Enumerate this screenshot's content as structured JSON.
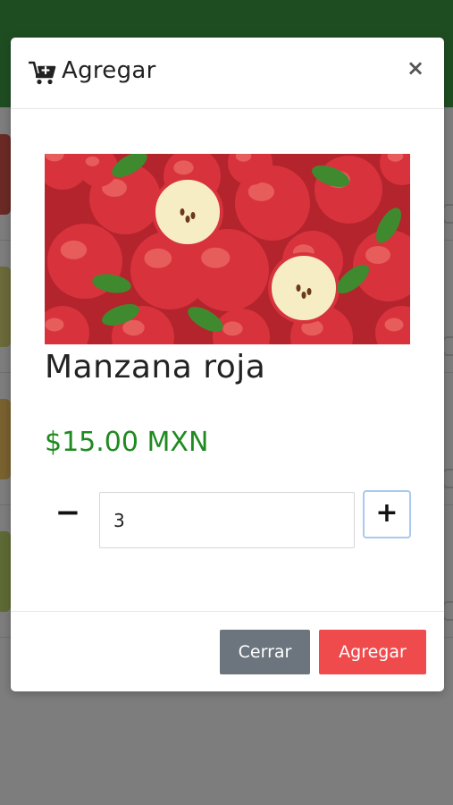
{
  "modal": {
    "title": "Agregar",
    "close_symbol": "×"
  },
  "product": {
    "name": "Manzana roja",
    "price": "$15.00 MXN",
    "image": "red-apples-photo"
  },
  "quantity": {
    "value": "3",
    "minus_symbol": "−",
    "plus_symbol": "+"
  },
  "footer": {
    "close_label": "Cerrar",
    "add_label": "Agregar"
  },
  "colors": {
    "header_green": "#1f4d22",
    "price_green": "#1f8a1f",
    "add_button": "#ef4b4d",
    "close_button": "#6c757d",
    "plus_focus": "#a9c9ee"
  },
  "icons": {
    "title": "cart-plus-icon",
    "close": "close-icon"
  }
}
